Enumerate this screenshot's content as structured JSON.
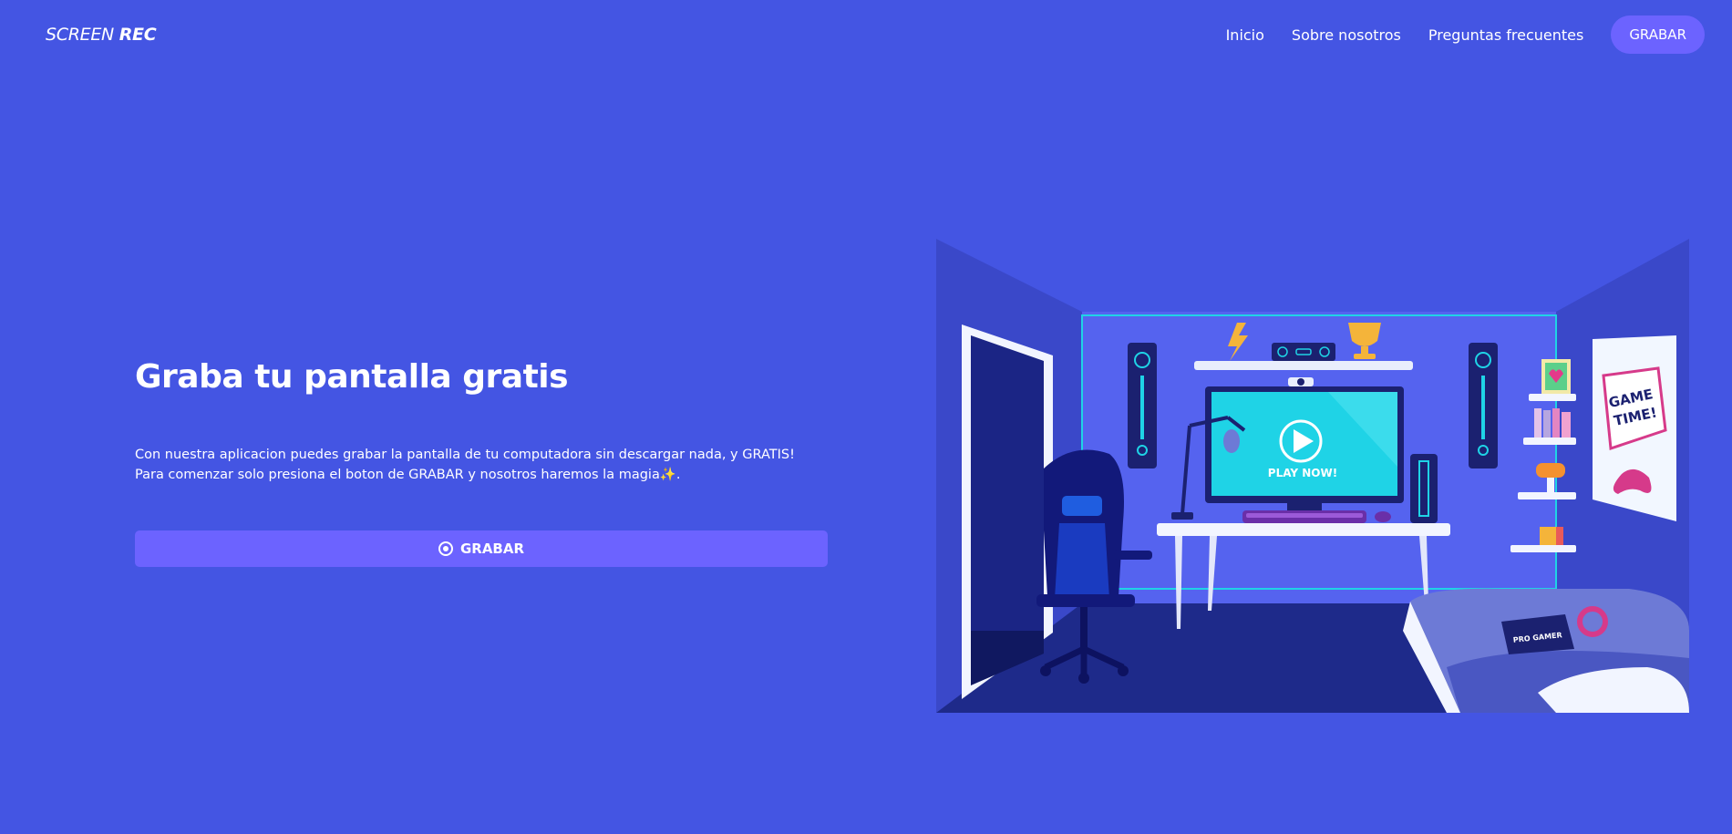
{
  "header": {
    "brand_light": "SCREEN",
    "brand_bold": "REC",
    "nav": [
      {
        "label": "Inicio"
      },
      {
        "label": "Sobre nosotros"
      },
      {
        "label": "Preguntas frecuentes"
      }
    ],
    "cta_label": "GRABAR"
  },
  "hero": {
    "title": "Graba tu pantalla gratis",
    "line1": "Con nuestra aplicacion puedes grabar la pantalla de tu computadora sin descargar nada, y GRATIS!",
    "line2_a": "Para comenzar solo presiona el boton de GRABAR y nosotros haremos la magia",
    "line2_sparkle": "✨",
    "line2_b": ".",
    "button_label": "GRABAR",
    "button_icon": "record-icon"
  },
  "illustration": {
    "play_label": "PLAY NOW!",
    "poster_line1": "GAME",
    "poster_line2": "TIME!",
    "book_label": "PRO GAMER"
  },
  "colors": {
    "background": "#4455e3",
    "accent": "#6c63ff",
    "screen": "#1fd3e6"
  }
}
